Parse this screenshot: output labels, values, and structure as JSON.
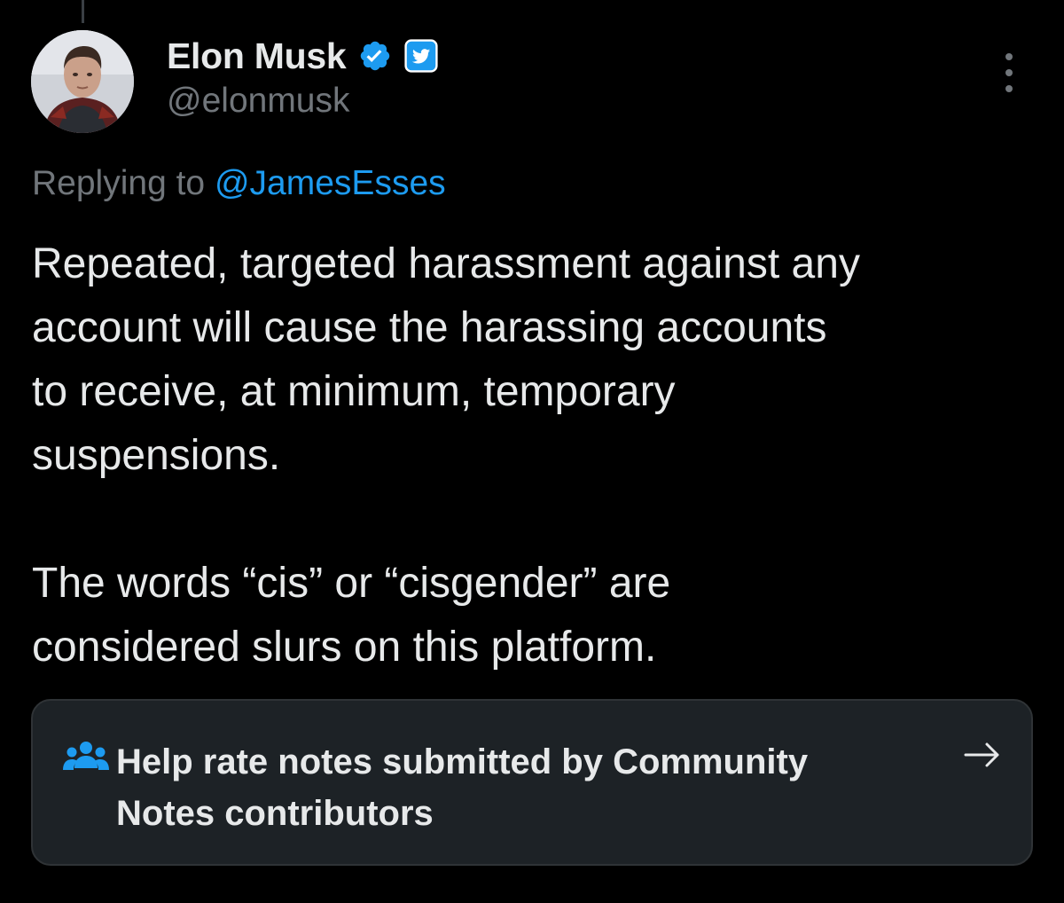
{
  "author": {
    "display_name": "Elon Musk",
    "handle": "@elonmusk",
    "verified_badge_icon": "verified-check-icon",
    "affiliate_badge_icon": "twitter-bird-badge-icon",
    "avatar_icon": "avatar"
  },
  "reply": {
    "prefix": "Replying to",
    "mention": "@JamesEsses"
  },
  "tweet": {
    "paragraph_1_lines": [
      "Repeated, targeted harassment against any",
      "account will cause the harassing accounts",
      "to receive, at minimum, temporary",
      "suspensions."
    ],
    "paragraph_2_lines": [
      "The words “cis” or “cisgender” are",
      "considered slurs on this platform."
    ]
  },
  "community_notes": {
    "icon": "people-icon",
    "lines": [
      "Help rate notes submitted by Community",
      "Notes contributors"
    ],
    "arrow_icon": "arrow-right-icon"
  },
  "more_menu_icon": "more-vertical-icon",
  "colors": {
    "background": "#000000",
    "text_primary": "#e7e9ea",
    "text_secondary": "#71767b",
    "accent": "#1d9bf0",
    "card_background": "#1d2226",
    "card_border": "#2f3336"
  }
}
